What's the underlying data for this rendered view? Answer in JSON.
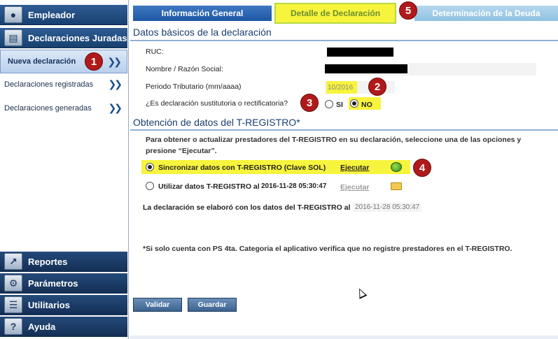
{
  "sidebar": {
    "empleador": "Empleador",
    "declaraciones": "Declaraciones Juradas",
    "items": [
      {
        "label": "Nueva declaración"
      },
      {
        "label": "Declaraciones registradas"
      },
      {
        "label": "Declaraciones generadas"
      }
    ],
    "reportes": "Reportes",
    "parametros": "Parámetros",
    "utilitarios": "Utilitarios",
    "ayuda": "Ayuda"
  },
  "tabs": {
    "general": "Información General",
    "detalle": "Detalle de Declaración",
    "deuda": "Determinación de la Deuda"
  },
  "section1": {
    "title": "Datos básicos de la declaración",
    "ruc_label": "RUC:",
    "nombre_label": "Nombre / Razón Social:",
    "periodo_label": "Periodo Tributario (mm/aaaa)",
    "periodo_value": "10/2016",
    "sustitutoria_label": "¿Es declaración sustitutoria o rectificatoria?",
    "si": "SI",
    "no": "NO"
  },
  "section2": {
    "title": "Obtención de datos del T-REGISTRO*",
    "paragraph": "Para obtener o actualizar prestadores del T-REGISTRO en su declaración, seleccione una de las opciones y presione “Ejecutar”.",
    "sync_label": "Sincronizar datos con T-REGISTRO (Clave SOL)",
    "ejecutar1": "Ejecutar",
    "utilizar_label": "Utilizar datos T-REGISTRO al",
    "utilizar_ts": "2016-11-28 05:30:47",
    "ejecutar2": "Ejecutar",
    "elaboro_label": "La declaración se elaboró con los datos del T-REGISTRO al",
    "elaboro_ts": "2016-11-28 05:30:47",
    "note": "*Si solo cuenta con PS 4ta. Categoria el aplicativo verifica que no registre prestadores en el T-REGISTRO."
  },
  "buttons": {
    "validar": "Validar",
    "guardar": "Guardar"
  },
  "badges": [
    "1",
    "2",
    "3",
    "4",
    "5"
  ],
  "colors": {
    "highlight": "#f7f43d",
    "sidebar_header": "#2f5d94",
    "badge": "#b01a1a"
  }
}
